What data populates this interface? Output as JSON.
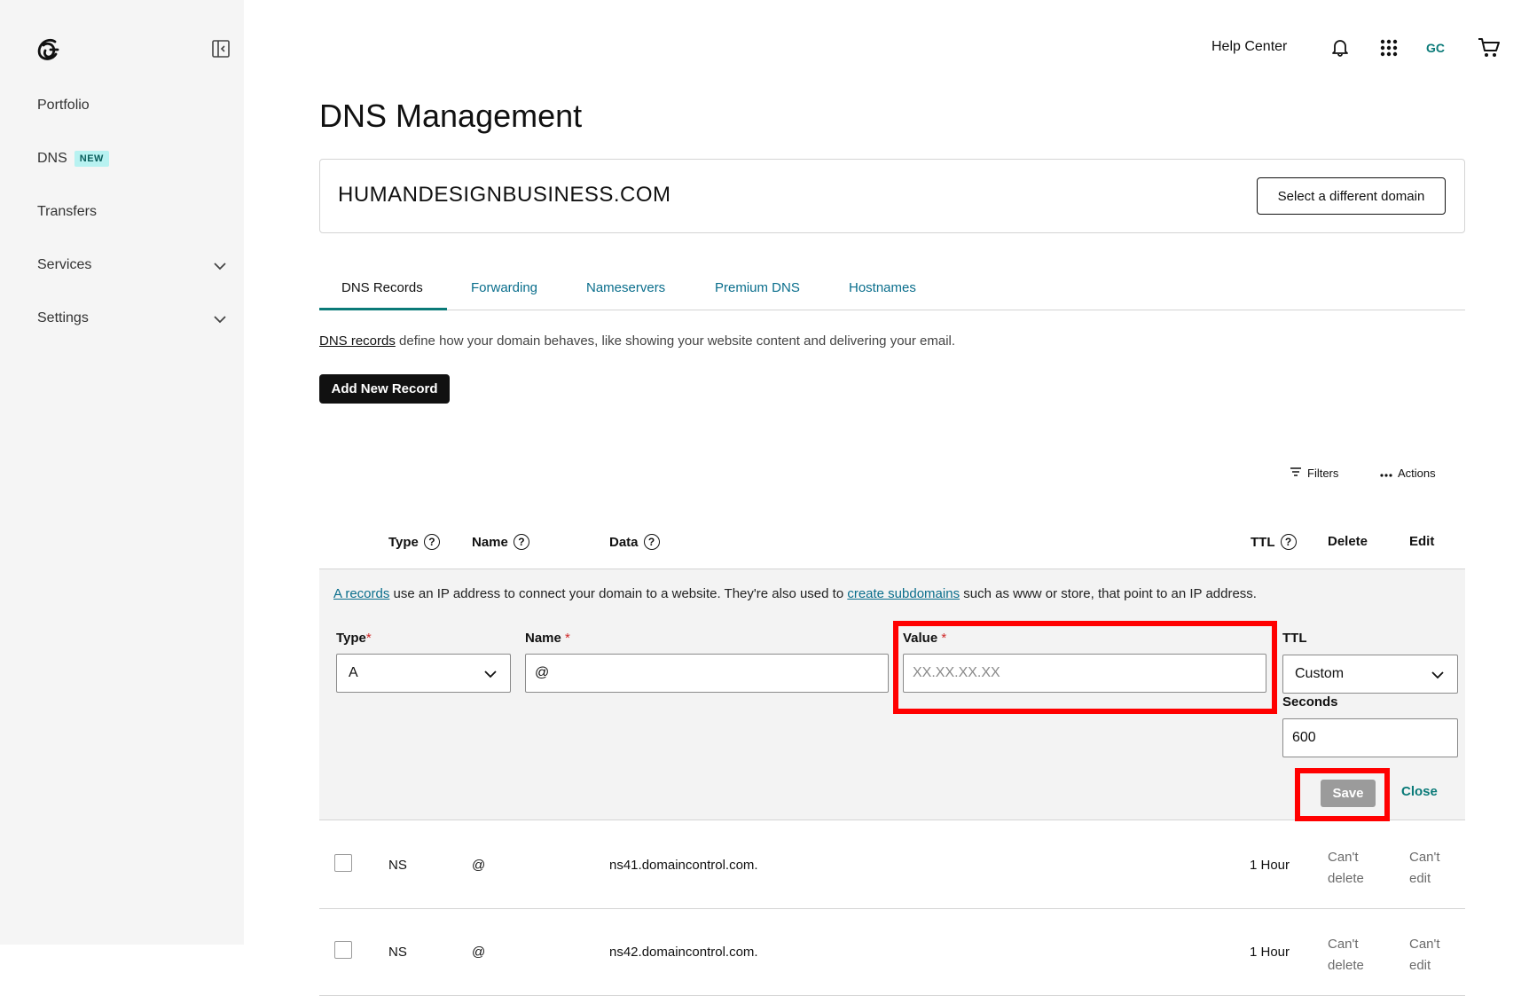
{
  "sidebar": {
    "logo": "godaddy-logo",
    "items": [
      {
        "label": "Portfolio"
      },
      {
        "label": "DNS",
        "badge": "NEW"
      },
      {
        "label": "Transfers"
      },
      {
        "label": "Services",
        "icon": "chevron-down-icon"
      },
      {
        "label": "Settings",
        "icon": "chevron-down-icon"
      }
    ]
  },
  "topbar": {
    "help": "Help Center",
    "avatar_initials": "GC",
    "icons": [
      "bell-icon",
      "apps-grid-icon",
      "cart-icon"
    ]
  },
  "page": {
    "title": "DNS Management"
  },
  "domain": {
    "name": "HUMANDESIGNBUSINESS.COM",
    "select_btn": "Select a different domain"
  },
  "tabs": [
    {
      "label": "DNS Records",
      "active": true
    },
    {
      "label": "Forwarding"
    },
    {
      "label": "Nameservers"
    },
    {
      "label": "Premium DNS"
    },
    {
      "label": "Hostnames"
    }
  ],
  "intro": {
    "link": "DNS records",
    "text": " define how your domain behaves, like showing your website content and delivering your email."
  },
  "add_record_btn": "Add New Record",
  "toolbar": {
    "filters": "Filters",
    "actions": "Actions"
  },
  "table_headers": {
    "type": "Type",
    "name": "Name",
    "data": "Data",
    "ttl": "TTL",
    "delete": "Delete",
    "edit": "Edit"
  },
  "edit_panel": {
    "intro_link1": "A records",
    "intro_text1": " use an IP address to connect your domain to a website. They're also used to ",
    "intro_link2": "create subdomains",
    "intro_text2": " such as www or store, that point to an IP address.",
    "type_label": "Type",
    "type_value": "A",
    "name_label": "Name",
    "name_value": "@",
    "value_label": "Value",
    "value_placeholder": "XX.XX.XX.XX",
    "ttl_label": "TTL",
    "ttl_value": "Custom",
    "seconds_label": "Seconds",
    "seconds_value": "600",
    "required_mark": "*",
    "save": "Save",
    "close": "Close"
  },
  "records": [
    {
      "type": "NS",
      "name": "@",
      "data": "ns41.domaincontrol.com.",
      "ttl": "1 Hour",
      "delete": "Can't delete",
      "edit": "Can't edit"
    },
    {
      "type": "NS",
      "name": "@",
      "data": "ns42.domaincontrol.com.",
      "ttl": "1 Hour",
      "delete": "Can't delete",
      "edit": "Can't edit"
    }
  ],
  "colors": {
    "accent": "#0a7a78",
    "link": "#0a6e8c",
    "highlight": "#ff0000",
    "sidebar_bg": "#f5f5f5"
  }
}
